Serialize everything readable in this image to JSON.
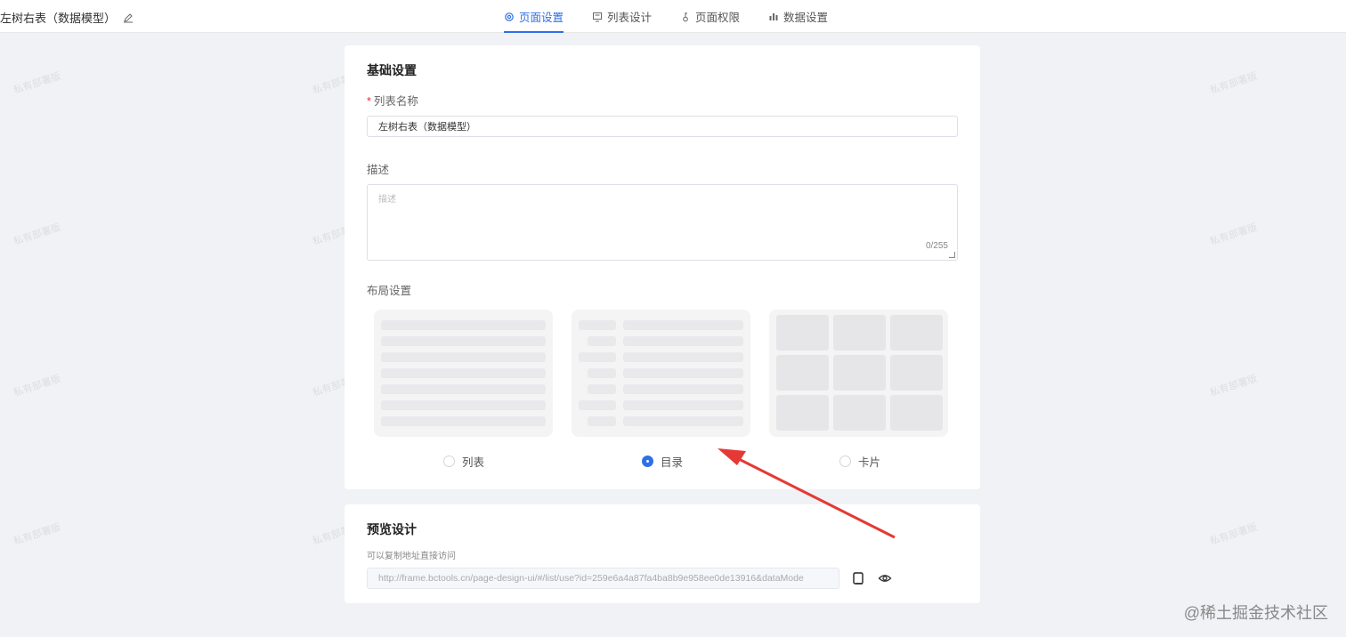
{
  "header": {
    "title": "左树右表（数据模型）",
    "tabs": [
      {
        "label": "页面设置",
        "icon": "gear-icon",
        "active": true
      },
      {
        "label": "列表设计",
        "icon": "list-design-icon",
        "active": false
      },
      {
        "label": "页面权限",
        "icon": "key-icon",
        "active": false
      },
      {
        "label": "数据设置",
        "icon": "bar-chart-icon",
        "active": false
      }
    ]
  },
  "basic": {
    "section_title": "基础设置",
    "name_label": "列表名称",
    "name_value": "左树右表（数据模型）",
    "desc_label": "描述",
    "desc_placeholder": "描述",
    "desc_counter": "0/255",
    "layout_label": "布局设置",
    "layouts": [
      {
        "label": "列表",
        "checked": false
      },
      {
        "label": "目录",
        "checked": true
      },
      {
        "label": "卡片",
        "checked": false
      }
    ]
  },
  "preview": {
    "section_title": "预览设计",
    "hint": "可以复制地址直接访问",
    "url": "http://frame.bctools.cn/page-design-ui/#/list/use?id=259e6a4a87fa4ba8b9e958ee0de13916&dataMode"
  },
  "watermark_text": "私有部署版",
  "brand": "@稀土掘金技术社区",
  "colors": {
    "accent": "#2f6fe6",
    "arrow": "#e53935"
  }
}
